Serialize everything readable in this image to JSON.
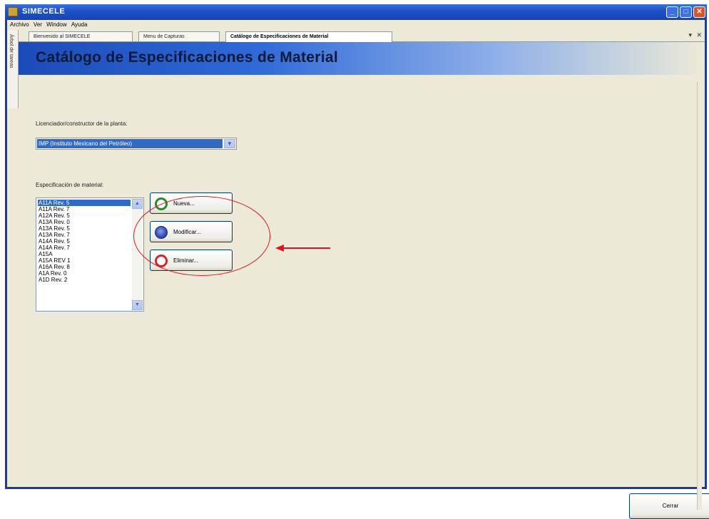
{
  "window": {
    "title": "SIMECELE"
  },
  "menu": [
    "Archivo",
    "Ver",
    "Window",
    "Ayuda"
  ],
  "side_panel": {
    "label": "Árbol de tareas"
  },
  "tabs": [
    {
      "label": "Bienvenido al SIMECELE",
      "active": false
    },
    {
      "label": "Menu de Capturas",
      "active": false
    },
    {
      "label": "Catálogo de Especificaciones de Material",
      "active": true
    }
  ],
  "tab_controls": "▾ ✕",
  "page": {
    "heading": "Catálogo de Especificaciones de Material",
    "licensor_label": "Licenciador/constructor de la planta:",
    "licensor_value": "IMP (Instituto Mexicano del Petróleo)",
    "spec_label": "Especificación de material:",
    "spec_items": [
      "A11A Rev. 5",
      "A11A Rev. 7",
      "A12A Rev. 5",
      "A13A Rev. 0",
      "A13A Rev. 5",
      "A13A Rev. 7",
      "A14A Rev. 5",
      "A14A Rev. 7",
      "A15A",
      "A15A REV 1",
      "A16A Rev. 8",
      "A1A Rev. 0",
      "A1D Rev. 2"
    ],
    "selected_index": 0,
    "buttons": {
      "nueva": "Nueva...",
      "modificar": "Modificar...",
      "eliminar": "Eliminar..."
    },
    "close_label": "Cerrar"
  },
  "colors": {
    "annotation": "#e0141e",
    "selection": "#316ac5",
    "titlebar": "#1d52c9"
  }
}
